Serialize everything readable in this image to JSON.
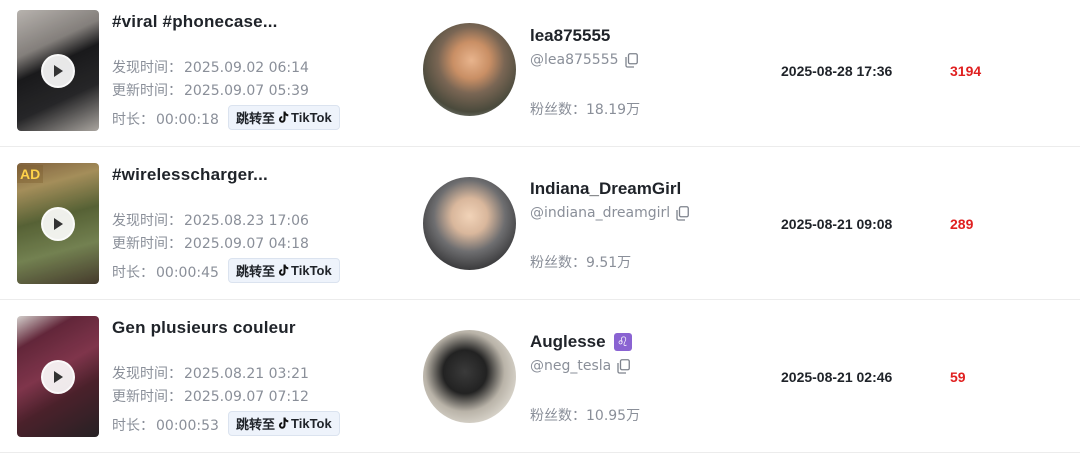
{
  "labels": {
    "found_time": "发现时间：",
    "updated_time": "更新时间：",
    "duration": "时长：",
    "jump_prefix": "跳转至",
    "jump_platform": "TikTok",
    "fans_prefix": "粉丝数："
  },
  "rows": [
    {
      "title": "#viral #phonecase...",
      "found": "2025.09.02 06:14",
      "updated": "2025.09.07 05:39",
      "duration": "00:00:18",
      "thumb_badge": "",
      "thumb_caption": "",
      "thumb_banner": "",
      "username": "lea875555",
      "handle": "@lea875555",
      "zodiac": "",
      "fans": "18.19万",
      "publish_time": "2025-08-28 17:36",
      "count": "3194"
    },
    {
      "title": "#wirelesscharger...",
      "found": "2025.08.23 17:06",
      "updated": "2025.09.07 04:18",
      "duration": "00:00:45",
      "thumb_badge": "AD",
      "thumb_caption": "",
      "thumb_banner": "",
      "username": "Indiana_DreamGirl",
      "handle": "@indiana_dreamgirl",
      "zodiac": "",
      "fans": "9.51万",
      "publish_time": "2025-08-21 09:08",
      "count": "289"
    },
    {
      "title": "Gen plusieurs couleur",
      "found": "2025.08.21 03:21",
      "updated": "2025.09.07 07:12",
      "duration": "00:00:53",
      "thumb_badge": "",
      "thumb_caption": "",
      "thumb_banner": "",
      "username": "Auglesse",
      "handle": "@neg_tesla",
      "zodiac": "♌",
      "fans": "10.95万",
      "publish_time": "2025-08-21 02:46",
      "count": "59"
    }
  ],
  "colors": {
    "count": "#e02020",
    "muted": "#8a8f99",
    "text": "#1f2329",
    "button_bg": "#eef3fb",
    "zodiac_bg": "#8a63d2"
  },
  "icons": {
    "play": "play-icon",
    "copy": "copy-icon",
    "tiktok": "tiktok-logo-icon"
  }
}
